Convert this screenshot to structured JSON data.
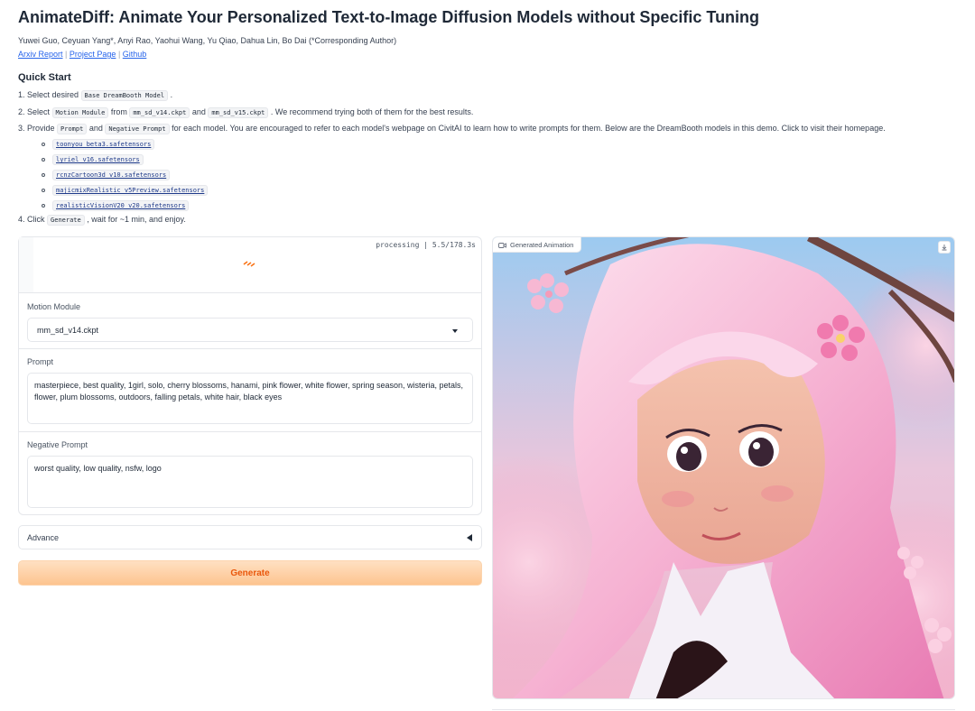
{
  "header": {
    "title": "AnimateDiff: Animate Your Personalized Text-to-Image Diffusion Models without Specific Tuning",
    "authors": "Yuwei Guo, Ceyuan Yang*, Anyi Rao, Yaohui Wang, Yu Qiao, Dahua Lin, Bo Dai (*Corresponding Author)",
    "links": [
      "Arxiv Report",
      "Project Page",
      "Github"
    ],
    "link_separator": "|"
  },
  "quick_start": {
    "title": "Quick Start",
    "step1": {
      "pre": "1. Select desired ",
      "code": "Base DreamBooth Model",
      "post": " ."
    },
    "step2": {
      "pre": "2. Select ",
      "code1": "Motion Module",
      "mid1": " from ",
      "code2": "mm_sd_v14.ckpt",
      "mid2": " and ",
      "code3": "mm_sd_v15.ckpt",
      "post": " . We recommend trying both of them for the best results."
    },
    "step3": {
      "pre": "3. Provide ",
      "code1": "Prompt",
      "mid1": " and ",
      "code2": "Negative Prompt",
      "post": " for each model. You are encouraged to refer to each model's webpage on CivitAI to learn how to write prompts for them. Below are the DreamBooth models in this demo. Click to visit their homepage."
    },
    "models": [
      "toonyou_beta3.safetensors",
      "lyriel_v16.safetensors",
      "rcnzCartoon3d_v10.safetensors",
      "majicmixRealistic_v5Preview.safetensors",
      "realisticVisionV20_v20.safetensors"
    ],
    "step4": {
      "pre": "4. Click ",
      "code": "Generate",
      "post": " , wait for ~1 min, and enjoy."
    }
  },
  "form": {
    "status": "processing | 5.5/178.3s",
    "motion_module": {
      "label": "Motion Module",
      "value": "mm_sd_v14.ckpt"
    },
    "prompt": {
      "label": "Prompt",
      "value": "masterpiece, best quality, 1girl, solo, cherry blossoms, hanami, pink flower, white flower, spring season, wisteria, petals, flower, plum blossoms, outdoors, falling petals, white hair, black eyes"
    },
    "negative_prompt": {
      "label": "Negative Prompt",
      "value": "worst quality, low quality, nsfw, logo"
    },
    "advance_label": "Advance",
    "generate_label": "Generate"
  },
  "output": {
    "label": "Generated Animation"
  },
  "colors": {
    "accent": "#ea580c",
    "link": "#2563eb",
    "generate_bg": "#fdc48f"
  }
}
